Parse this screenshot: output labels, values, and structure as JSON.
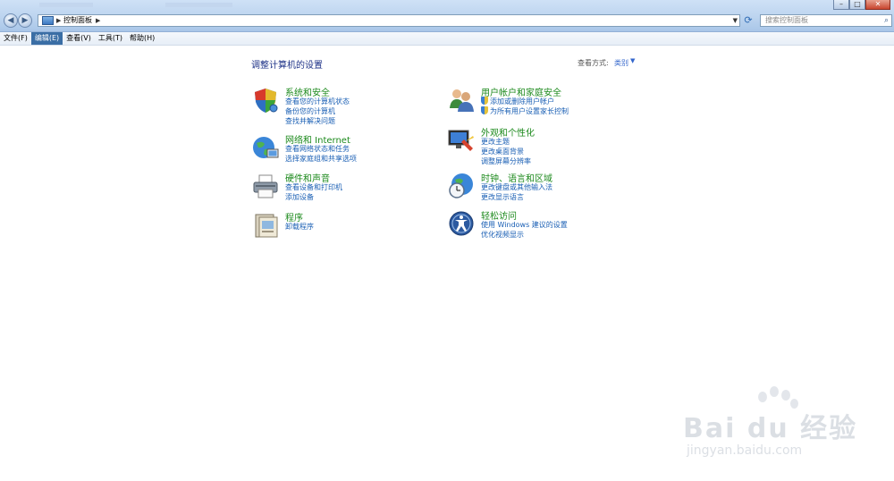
{
  "window": {
    "address": {
      "path": "控制面板"
    },
    "search": {
      "placeholder": "搜索控制面板"
    },
    "window_buttons": [
      "minimize-icon",
      "maximize-icon",
      "close-icon"
    ]
  },
  "menubar": {
    "items": [
      {
        "label": "文件(F)"
      },
      {
        "label": "编辑(E)"
      },
      {
        "label": "查看(V)"
      },
      {
        "label": "工具(T)"
      },
      {
        "label": "帮助(H)"
      }
    ],
    "active_index": 1
  },
  "main": {
    "title": "调整计算机的设置",
    "view_by_label": "查看方式:",
    "view_by_value": "类别"
  },
  "categories": [
    {
      "title": "系统和安全",
      "icon": "shield-icon",
      "links": [
        "查看您的计算机状态",
        "备份您的计算机",
        "查找并解决问题"
      ]
    },
    {
      "title": "网络和 Internet",
      "icon": "network-globe-icon",
      "links": [
        "查看网络状态和任务",
        "选择家庭组和共享选项"
      ]
    },
    {
      "title": "硬件和声音",
      "icon": "printer-icon",
      "links": [
        "查看设备和打印机",
        "添加设备"
      ]
    },
    {
      "title": "程序",
      "icon": "programs-icon",
      "links": [
        "卸载程序"
      ]
    },
    {
      "title": "用户帐户和家庭安全",
      "icon": "users-icon",
      "links": [
        "添加或删除用户帐户",
        "为所有用户设置家长控制"
      ]
    },
    {
      "title": "外观和个性化",
      "icon": "display-icon",
      "links": [
        "更改主题",
        "更改桌面背景",
        "调整屏幕分辨率"
      ]
    },
    {
      "title": "时钟、语言和区域",
      "icon": "clock-globe-icon",
      "links": [
        "更改键盘或其他输入法",
        "更改显示语言"
      ]
    },
    {
      "title": "轻松访问",
      "icon": "ease-of-access-icon",
      "links": [
        "使用 Windows 建议的设置",
        "优化视频显示"
      ]
    }
  ],
  "watermark": {
    "brand": "Bai du 经验",
    "url": "jingyan.baidu.com"
  }
}
